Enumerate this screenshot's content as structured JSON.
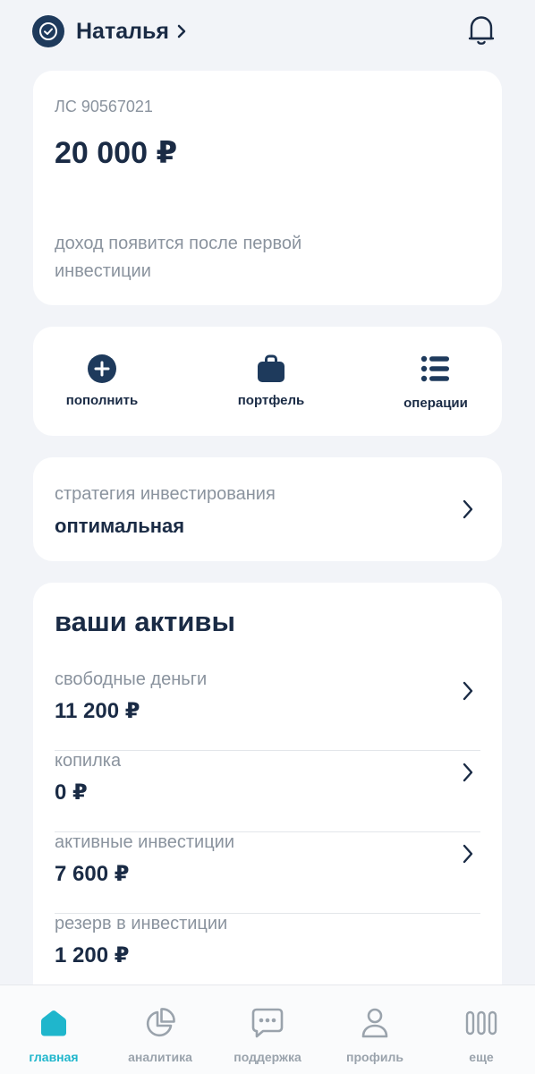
{
  "header": {
    "user_name": "Наталья"
  },
  "account_card": {
    "account_number": "ЛС 90567021",
    "balance": "20 000 ₽",
    "income_note": "доход появится после первой инвестиции"
  },
  "actions": [
    {
      "label": "пополнить",
      "icon": "plus-circle-icon"
    },
    {
      "label": "портфель",
      "icon": "briefcase-icon"
    },
    {
      "label": "операции",
      "icon": "list-icon"
    }
  ],
  "strategy": {
    "label": "стратегия инвестирования",
    "value": "оптимальная"
  },
  "assets": {
    "title": "ваши активы",
    "items": [
      {
        "label": "свободные деньги",
        "value": "11 200 ₽"
      },
      {
        "label": "копилка",
        "value": "0 ₽"
      },
      {
        "label": "активные инвестиции",
        "value": "7 600 ₽"
      },
      {
        "label": "резерв в инвестиции",
        "value": "1 200 ₽"
      }
    ]
  },
  "tabbar": {
    "items": [
      {
        "label": "главная",
        "icon": "home-icon",
        "active": true
      },
      {
        "label": "аналитика",
        "icon": "pie-chart-icon",
        "active": false
      },
      {
        "label": "поддержка",
        "icon": "chat-icon",
        "active": false
      },
      {
        "label": "профиль",
        "icon": "user-icon",
        "active": false
      },
      {
        "label": "еще",
        "icon": "more-icon",
        "active": false
      }
    ]
  },
  "colors": {
    "background": "#f2f4f8",
    "card": "#ffffff",
    "text_primary": "#1a2b45",
    "text_secondary": "#8a939e",
    "accent": "#1fb6cc",
    "tab_inactive": "#9aa3ac"
  }
}
